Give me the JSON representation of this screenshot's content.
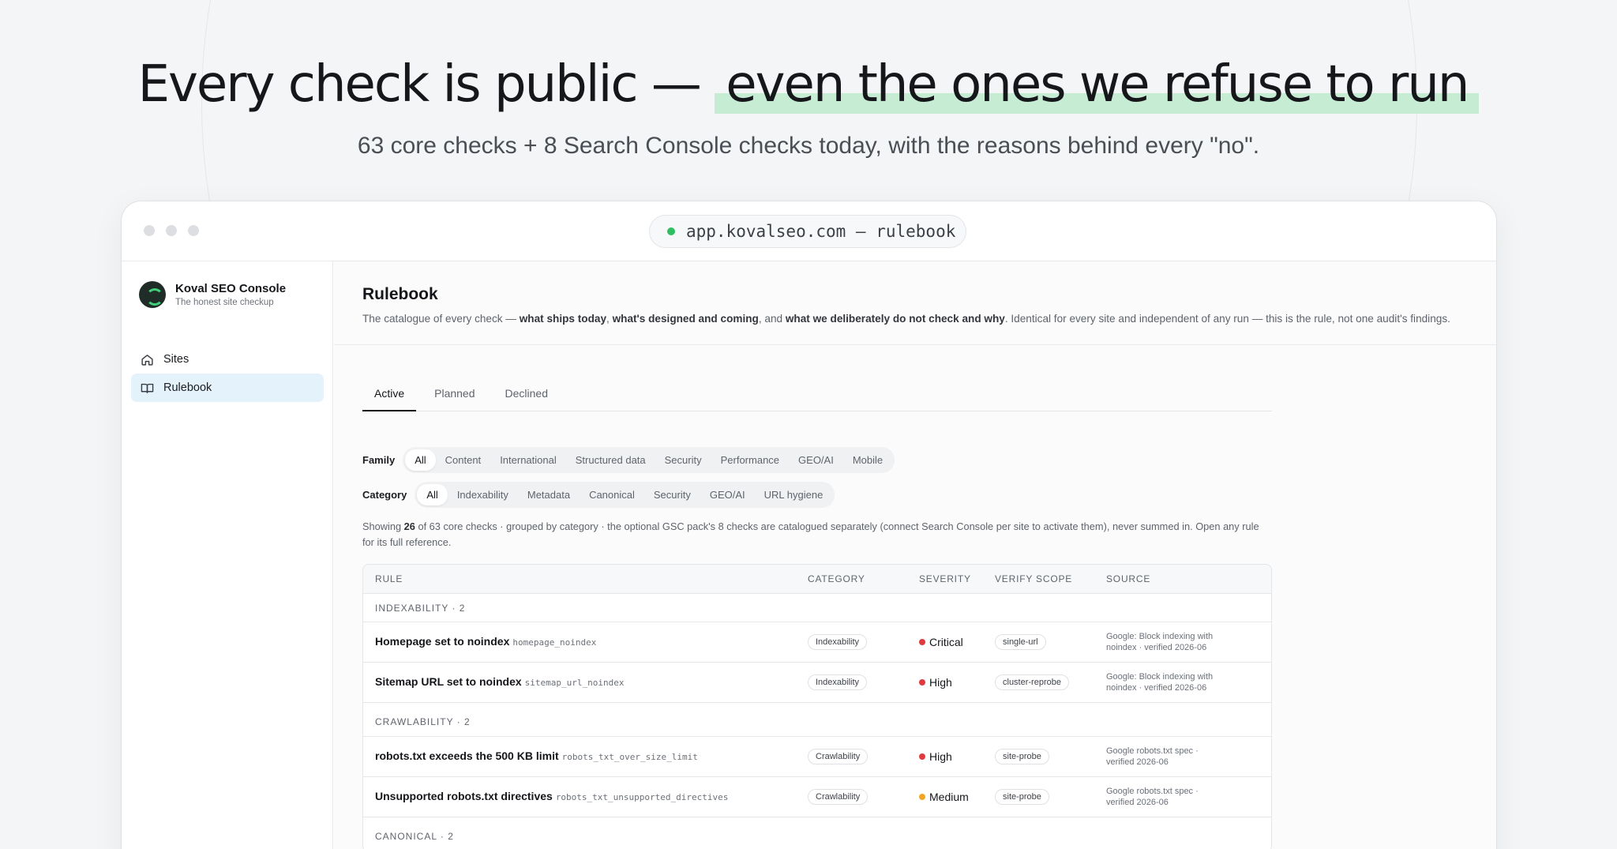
{
  "hero": {
    "title_plain": "Every check is public — ",
    "title_highlight": "even the ones we refuse to run",
    "subtitle": "63 core checks + 8 Search Console checks today, with the reasons behind every \"no\"."
  },
  "window": {
    "url": "app.kovalseo.com — rulebook"
  },
  "sidebar": {
    "brand_name": "Koval SEO Console",
    "brand_tagline": "The honest site checkup",
    "items": [
      {
        "label": "Sites",
        "icon": "home-icon"
      },
      {
        "label": "Rulebook",
        "icon": "book-icon"
      }
    ]
  },
  "page": {
    "title": "Rulebook",
    "desc_1": "The catalogue of every check — ",
    "desc_b1": "what ships today",
    "desc_2": ", ",
    "desc_b2": "what's designed and coming",
    "desc_3": ", and ",
    "desc_b3": "what we deliberately do not check and why",
    "desc_4": ". Identical for every site and independent of any run — this is the rule, not one audit's findings."
  },
  "tabs": [
    "Active",
    "Planned",
    "Declined"
  ],
  "filters": {
    "family_label": "Family",
    "family": [
      "All",
      "Content",
      "International",
      "Structured data",
      "Security",
      "Performance",
      "GEO/AI",
      "Mobile"
    ],
    "category_label": "Category",
    "category": [
      "All",
      "Indexability",
      "Metadata",
      "Canonical",
      "Security",
      "GEO/AI",
      "URL hygiene"
    ]
  },
  "showing": {
    "pre": "Showing ",
    "count": "26",
    "post": " of 63 core checks · grouped by category · the optional GSC pack's 8 checks are catalogued separately (connect Search Console per site to activate them), never summed in. Open any rule for its full reference."
  },
  "table": {
    "headers": [
      "RULE",
      "CATEGORY",
      "SEVERITY",
      "VERIFY SCOPE",
      "SOURCE"
    ],
    "groups": [
      {
        "label": "INDEXABILITY · 2",
        "rows": [
          {
            "name": "Homepage set to noindex",
            "id": "homepage_noindex",
            "category": "Indexability",
            "severity": "Critical",
            "scope": "single-url",
            "source_1": "Google: Block indexing with",
            "source_2": "noindex · verified 2026-06"
          },
          {
            "name": "Sitemap URL set to noindex",
            "id": "sitemap_url_noindex",
            "category": "Indexability",
            "severity": "High",
            "scope": "cluster-reprobe",
            "source_1": "Google: Block indexing with",
            "source_2": "noindex · verified 2026-06"
          }
        ]
      },
      {
        "label": "CRAWLABILITY · 2",
        "rows": [
          {
            "name": "robots.txt exceeds the 500 KB limit",
            "id": "robots_txt_over_size_limit",
            "category": "Crawlability",
            "severity": "High",
            "scope": "site-probe",
            "source_1": "Google robots.txt spec ·",
            "source_2": "verified 2026-06"
          },
          {
            "name": "Unsupported robots.txt directives",
            "id": "robots_txt_unsupported_directives",
            "category": "Crawlability",
            "severity": "Medium",
            "scope": "site-probe",
            "source_1": "Google robots.txt spec ·",
            "source_2": "verified 2026-06"
          }
        ]
      },
      {
        "label": "CANONICAL · 2",
        "rows": []
      }
    ]
  },
  "colors": {
    "critical": "#e0393e",
    "high": "#e0393e",
    "medium": "#f2a623",
    "accent_highlight": "#c6ecd4",
    "url_dot": "#2fbf62"
  }
}
